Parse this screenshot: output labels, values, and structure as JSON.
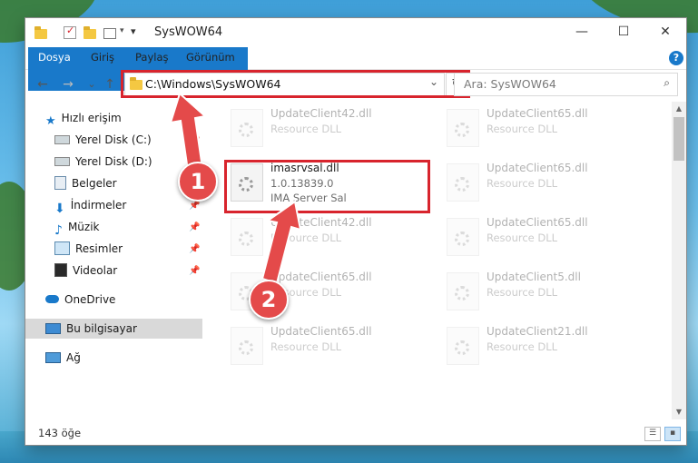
{
  "window": {
    "title": "SysWOW64",
    "controls": {
      "minimize": "—",
      "maximize": "☐",
      "close": "✕"
    }
  },
  "ribbon": {
    "tabs": [
      {
        "label": "Dosya",
        "active": true
      },
      {
        "label": "Giriş"
      },
      {
        "label": "Paylaş"
      },
      {
        "label": "Görünüm"
      }
    ],
    "help": "?"
  },
  "nav": {
    "back": "←",
    "forward": "→",
    "recent": "⌄",
    "up": "↑",
    "address": "C:\\Windows\\SysWOW64",
    "search_placeholder": "Ara: SysWOW64"
  },
  "sidebar": {
    "items": [
      {
        "label": "Hızlı erişim"
      },
      {
        "label": "Yerel Disk (C:)"
      },
      {
        "label": "Yerel Disk (D:)"
      },
      {
        "label": "Belgeler"
      },
      {
        "label": "İndirmeler"
      },
      {
        "label": "Müzik"
      },
      {
        "label": "Resimler"
      },
      {
        "label": "Videolar"
      },
      {
        "label": "OneDrive"
      },
      {
        "label": "Bu bilgisayar"
      },
      {
        "label": "Ağ"
      }
    ]
  },
  "files": {
    "left": [
      {
        "name": "UpdateClient42.dll",
        "desc": "Resource DLL"
      },
      {
        "name": "imasrvsal.dll",
        "version": "1.0.13839.0",
        "company": "IMA Server Sal",
        "highlight": true
      },
      {
        "name": "UpdateClient42.dll",
        "desc": "Resource DLL"
      },
      {
        "name": "UpdateClient65.dll",
        "desc": "Resource DLL"
      },
      {
        "name": "UpdateClient65.dll",
        "desc": "Resource DLL"
      }
    ],
    "right": [
      {
        "name": "UpdateClient65.dll",
        "desc": "Resource DLL"
      },
      {
        "name": "UpdateClient65.dll",
        "desc": "Resource DLL"
      },
      {
        "name": "UpdateClient65.dll",
        "desc": "Resource DLL"
      },
      {
        "name": "UpdateClient5.dll",
        "desc": "Resource DLL"
      },
      {
        "name": "UpdateClient21.dll",
        "desc": "Resource DLL"
      }
    ]
  },
  "status": {
    "count": "143 öğe"
  },
  "annotations": {
    "badge1": "1",
    "badge2": "2"
  },
  "colors": {
    "accent": "#1979ca",
    "highlight": "#d8242d",
    "badge": "#e44a4a"
  }
}
